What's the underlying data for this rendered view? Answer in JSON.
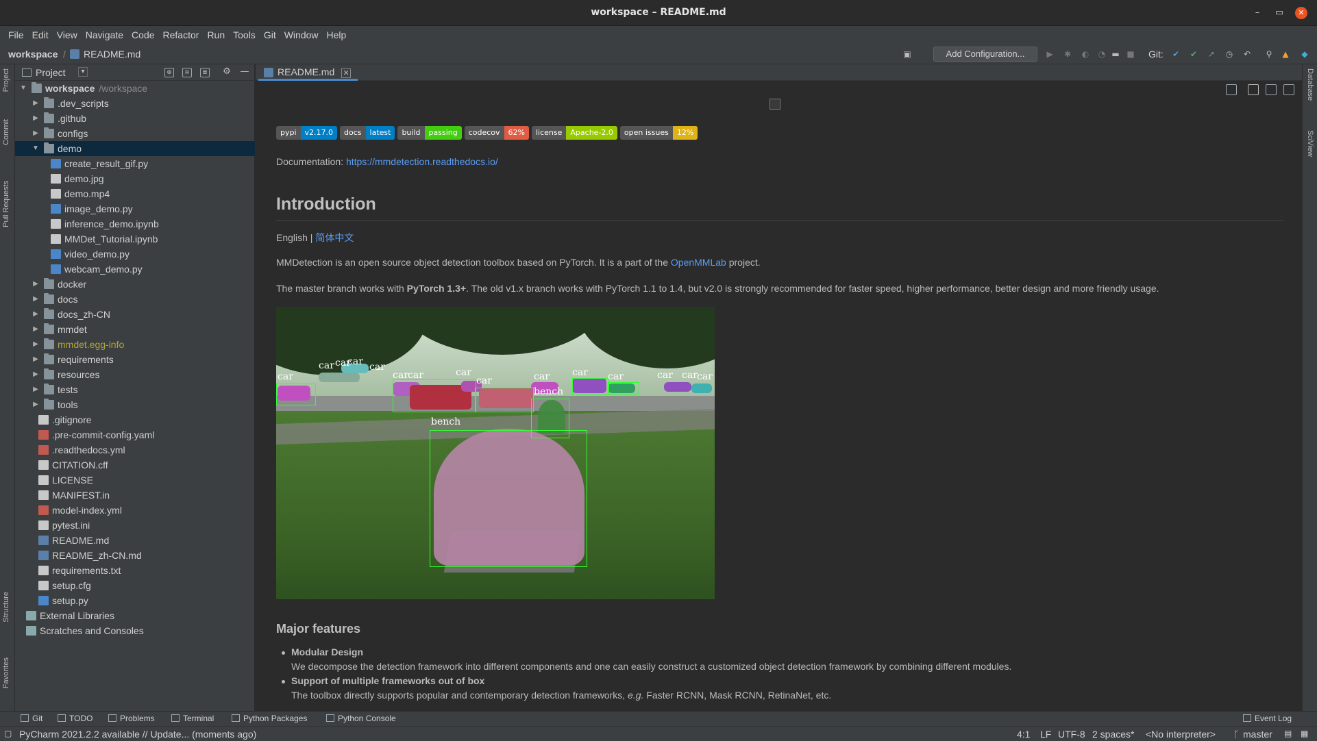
{
  "window": {
    "title": "workspace – README.md",
    "minimize": "–",
    "maximize": "▭",
    "close": "✕"
  },
  "menu": [
    "File",
    "Edit",
    "View",
    "Navigate",
    "Code",
    "Refactor",
    "Run",
    "Tools",
    "Git",
    "Window",
    "Help"
  ],
  "nav": {
    "root": "workspace",
    "sep": "/",
    "file": "README.md",
    "add_configuration": "Add Configuration...",
    "git_label": "Git:"
  },
  "left_strip": [
    "Project",
    "Commit",
    "Pull Requests",
    "Structure",
    "Favorites"
  ],
  "right_strip": [
    "Database",
    "SciView"
  ],
  "project": {
    "title": "Project",
    "tree": [
      {
        "name": "workspace",
        "hint": "/workspace",
        "type": "folder",
        "depth": 0,
        "expanded": true
      },
      {
        "name": ".dev_scripts",
        "type": "folder",
        "depth": 1
      },
      {
        "name": ".github",
        "type": "folder",
        "depth": 1
      },
      {
        "name": "configs",
        "type": "folder",
        "depth": 1
      },
      {
        "name": "demo",
        "type": "folder",
        "depth": 1,
        "expanded": true,
        "selected": true
      },
      {
        "name": "create_result_gif.py",
        "type": "py",
        "depth": 2
      },
      {
        "name": "demo.jpg",
        "type": "file",
        "depth": 2
      },
      {
        "name": "demo.mp4",
        "type": "file",
        "depth": 2
      },
      {
        "name": "image_demo.py",
        "type": "py",
        "depth": 2
      },
      {
        "name": "inference_demo.ipynb",
        "type": "file",
        "depth": 2
      },
      {
        "name": "MMDet_Tutorial.ipynb",
        "type": "file",
        "depth": 2
      },
      {
        "name": "video_demo.py",
        "type": "py",
        "depth": 2
      },
      {
        "name": "webcam_demo.py",
        "type": "py",
        "depth": 2
      },
      {
        "name": "docker",
        "type": "folder",
        "depth": 1
      },
      {
        "name": "docs",
        "type": "folder",
        "depth": 1
      },
      {
        "name": "docs_zh-CN",
        "type": "folder",
        "depth": 1
      },
      {
        "name": "mmdet",
        "type": "folder",
        "depth": 1
      },
      {
        "name": "mmdet.egg-info",
        "type": "folder",
        "depth": 1,
        "egg": true
      },
      {
        "name": "requirements",
        "type": "folder",
        "depth": 1
      },
      {
        "name": "resources",
        "type": "folder",
        "depth": 1
      },
      {
        "name": "tests",
        "type": "folder",
        "depth": 1
      },
      {
        "name": "tools",
        "type": "folder",
        "depth": 1
      },
      {
        "name": ".gitignore",
        "type": "file",
        "depth": 1,
        "leaf": true
      },
      {
        "name": ".pre-commit-config.yaml",
        "type": "yml",
        "depth": 1,
        "leaf": true
      },
      {
        "name": ".readthedocs.yml",
        "type": "yml",
        "depth": 1,
        "leaf": true
      },
      {
        "name": "CITATION.cff",
        "type": "file",
        "depth": 1,
        "leaf": true
      },
      {
        "name": "LICENSE",
        "type": "file",
        "depth": 1,
        "leaf": true
      },
      {
        "name": "MANIFEST.in",
        "type": "file",
        "depth": 1,
        "leaf": true
      },
      {
        "name": "model-index.yml",
        "type": "yml",
        "depth": 1,
        "leaf": true
      },
      {
        "name": "pytest.ini",
        "type": "file",
        "depth": 1,
        "leaf": true
      },
      {
        "name": "README.md",
        "type": "md",
        "depth": 1,
        "leaf": true
      },
      {
        "name": "README_zh-CN.md",
        "type": "md",
        "depth": 1,
        "leaf": true
      },
      {
        "name": "requirements.txt",
        "type": "file",
        "depth": 1,
        "leaf": true
      },
      {
        "name": "setup.cfg",
        "type": "file",
        "depth": 1,
        "leaf": true
      },
      {
        "name": "setup.py",
        "type": "py",
        "depth": 1,
        "leaf": true
      },
      {
        "name": "External Libraries",
        "type": "lib",
        "depth": 0,
        "leaf": true
      },
      {
        "name": "Scratches and Consoles",
        "type": "lib",
        "depth": 0,
        "leaf": true
      }
    ]
  },
  "editor": {
    "tab": "README.md"
  },
  "readme": {
    "badges": [
      {
        "l": "pypi",
        "r": "v2.17.0",
        "color": "#007ec6"
      },
      {
        "l": "docs",
        "r": "latest",
        "color": "#007ec6"
      },
      {
        "l": "build",
        "r": "passing",
        "color": "#44cc11"
      },
      {
        "l": "codecov",
        "r": "62%",
        "color": "#e05d44"
      },
      {
        "l": "license",
        "r": "Apache-2.0",
        "color": "#97ca00"
      },
      {
        "l": "open issues",
        "r": "12%",
        "color": "#dfb317"
      }
    ],
    "doc_prefix": "Documentation: ",
    "doc_link": "https://mmdetection.readthedocs.io/",
    "h1": "Introduction",
    "lang_en": "English | ",
    "lang_zh": "简体中文",
    "p1_a": "MMDetection is an open source object detection toolbox based on PyTorch. It is a part of the ",
    "p1_link": "OpenMMLab",
    "p1_b": " project.",
    "p2_a": "The master branch works with ",
    "p2_bold": "PyTorch 1.3+",
    "p2_b": ". The old v1.x branch works with PyTorch 1.1 to 1.4, but v2.0 is strongly recommended for faster speed, higher performance, better design and more friendly usage.",
    "image_labels": {
      "car": "car",
      "bench": "bench"
    },
    "h2": "Major features",
    "features": [
      {
        "title": "Modular Design",
        "desc": "We decompose the detection framework into different components and one can easily construct a customized object detection framework by combining different modules."
      },
      {
        "title": "Support of multiple frameworks out of box",
        "desc_a": "The toolbox directly supports popular and contemporary detection frameworks, ",
        "desc_em": "e.g.",
        "desc_b": " Faster RCNN, Mask RCNN, RetinaNet, etc."
      }
    ]
  },
  "bottom_tabs": [
    "Git",
    "TODO",
    "Problems",
    "Terminal",
    "Python Packages",
    "Python Console"
  ],
  "event_log": "Event Log",
  "status": {
    "message": "PyCharm 2021.2.2 available // Update... (moments ago)",
    "position": "4:1",
    "line_sep": "LF",
    "encoding": "UTF-8",
    "indent": "2 spaces*",
    "interpreter": "<No interpreter>",
    "branch": "master"
  }
}
